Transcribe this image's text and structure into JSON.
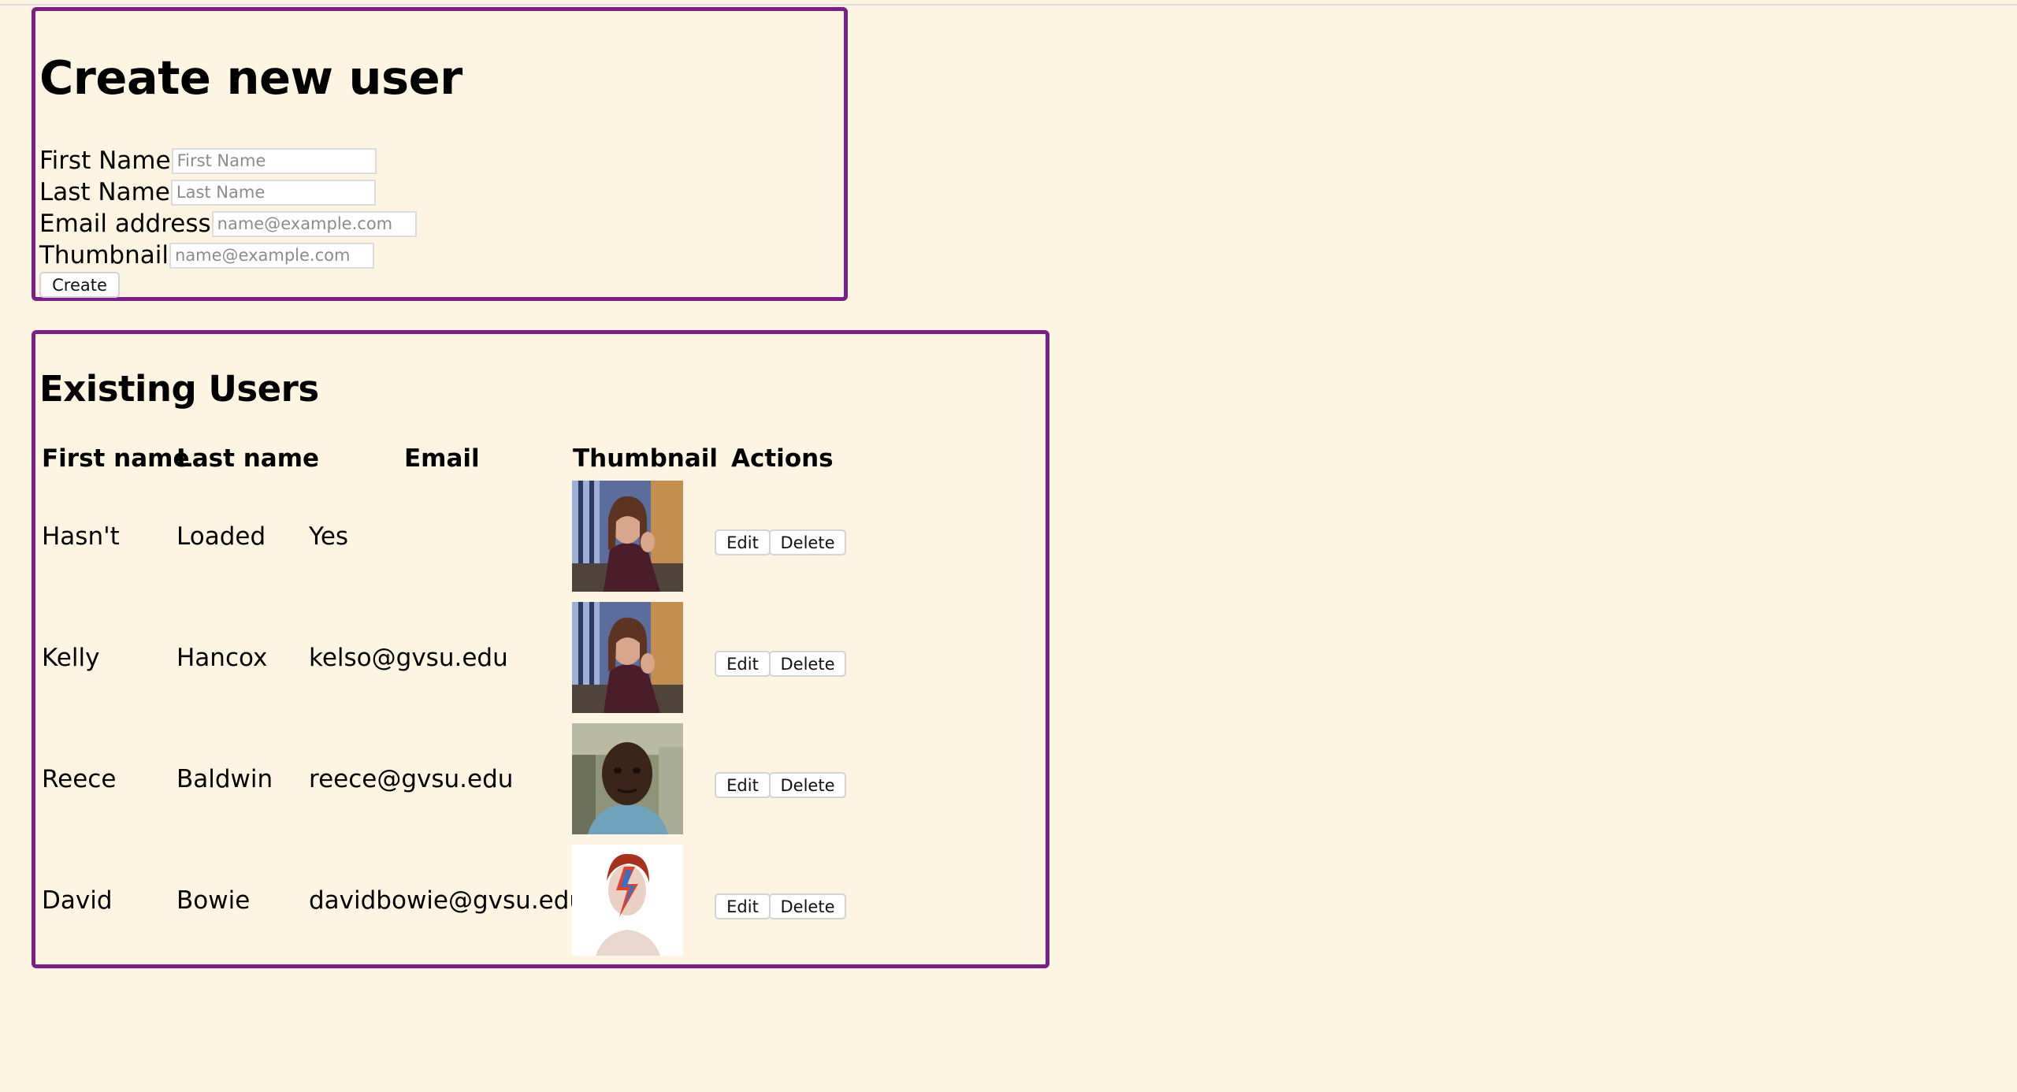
{
  "create_form": {
    "title": "Create new user",
    "fields": {
      "first_name": {
        "label": "First Name",
        "placeholder": "First Name",
        "value": ""
      },
      "last_name": {
        "label": "Last Name",
        "placeholder": "Last Name",
        "value": ""
      },
      "email": {
        "label": "Email address",
        "placeholder": "name@example.com",
        "value": ""
      },
      "thumbnail": {
        "label": "Thumbnail",
        "placeholder": "name@example.com",
        "value": ""
      }
    },
    "create_label": "Create"
  },
  "users_table": {
    "title": "Existing Users",
    "columns": {
      "first_name": "First name",
      "last_name": "Last name",
      "email": "Email",
      "thumbnail": "Thumbnail",
      "actions": "Actions"
    },
    "rows": [
      {
        "first_name": "Hasn't",
        "last_name": "Loaded",
        "email": "Yes",
        "thumbnail": "woman-portrait-thumbnail",
        "edit": "Edit",
        "delete": "Delete"
      },
      {
        "first_name": "Kelly",
        "last_name": "Hancox",
        "email": "kelso@gvsu.edu",
        "thumbnail": "woman-portrait-thumbnail",
        "edit": "Edit",
        "delete": "Delete"
      },
      {
        "first_name": "Reece",
        "last_name": "Baldwin",
        "email": "reece@gvsu.edu",
        "thumbnail": "man-portrait-thumbnail",
        "edit": "Edit",
        "delete": "Delete"
      },
      {
        "first_name": "David",
        "last_name": "Bowie",
        "email": "davidbowie@gvsu.edu",
        "thumbnail": "lightning-face-portrait-thumbnail",
        "edit": "Edit",
        "delete": "Delete"
      }
    ]
  },
  "colors": {
    "page_background": "#fdf5e2",
    "panel_border": "#7b1f86"
  }
}
